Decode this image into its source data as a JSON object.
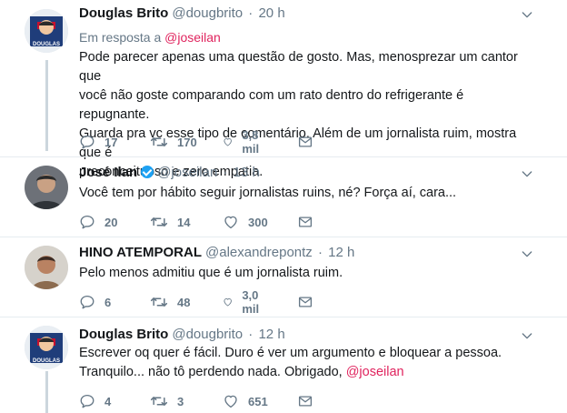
{
  "tweets": [
    {
      "name": "Douglas Brito",
      "handle": "@dougbrito",
      "time": "20 h",
      "reply_prefix": "Em resposta a",
      "reply_to": "@joseilan",
      "lines": [
        "Pode parecer apenas uma questão de gosto. Mas, menosprezar um cantor que",
        "você não goste comparando com um rato dentro do refrigerante é repugnante.",
        "Guarda pra vc esse tipo de comentário. Além de um jornalista ruim, mostra que é",
        "preconceituoso e zero empatia."
      ],
      "replies": "17",
      "retweets": "170",
      "likes": "3,8 mil"
    },
    {
      "name": "José Ilan",
      "handle": "@joseilan",
      "time": "13 h",
      "text": "Você tem por hábito seguir jornalistas ruins, né? Força aí, cara...",
      "replies": "20",
      "retweets": "14",
      "likes": "300"
    },
    {
      "name": "HINO ATEMPORAL",
      "handle": "@alexandrepontz",
      "time": "12 h",
      "text": "Pelo menos admitiu que é um jornalista ruim.",
      "replies": "6",
      "retweets": "48",
      "likes": "3,0 mil"
    },
    {
      "name": "Douglas Brito",
      "handle": "@dougbrito",
      "time": "12 h",
      "line1": "Escrever oq quer é fácil. Duro é ver um argumento e bloquear a pessoa.",
      "line2_prefix": "Tranquilo... não tô perdendo nada. Obrigado, ",
      "line2_mention": "@joseilan",
      "replies": "4",
      "retweets": "3",
      "likes": "651"
    }
  ],
  "avatar_label": "DOUGLAS",
  "colors": {
    "mention": "#e0245e",
    "muted": "#657786",
    "verified": "#1da1f2",
    "thread_line": "#ccd6dd"
  }
}
